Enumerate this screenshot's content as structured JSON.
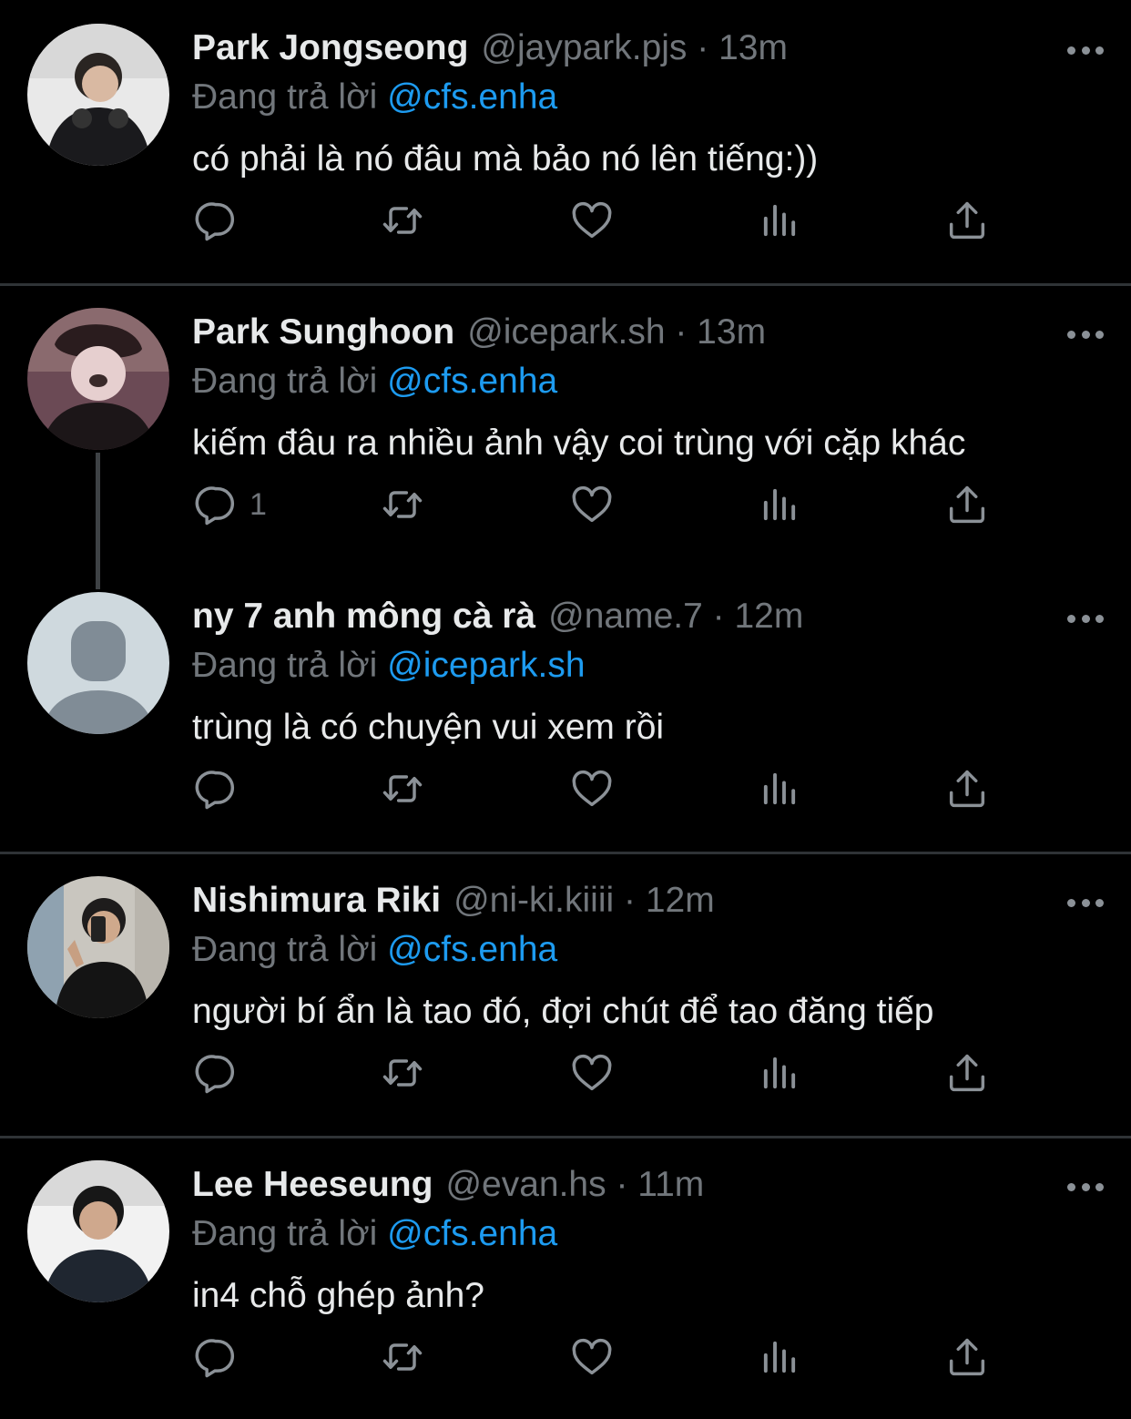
{
  "reply_prefix": "Đang trả lời",
  "tweets": [
    {
      "name": "Park Jongseong",
      "meta": "@jaypark.pjs · 13m",
      "reply_to": "@cfs.enha",
      "text": "có phải là nó đâu mà bảo nó lên tiếng:))",
      "reply_count": ""
    },
    {
      "name": "Park Sunghoon",
      "meta": "@icepark.sh · 13m",
      "reply_to": "@cfs.enha",
      "text": "kiếm đâu ra nhiều ảnh vậy coi trùng với cặp khác",
      "reply_count": "1"
    },
    {
      "name": "ny 7 anh mông cà rà",
      "meta": "@name.7 · 12m",
      "reply_to": "@icepark.sh",
      "text": "trùng là có chuyện vui xem rồi",
      "reply_count": ""
    },
    {
      "name": "Nishimura Riki",
      "meta": "@ni-ki.kiiii · 12m",
      "reply_to": "@cfs.enha",
      "text": "người bí ẩn là tao đó, đợi chút để tao đăng tiếp",
      "reply_count": ""
    },
    {
      "name": "Lee Heeseung",
      "meta": "@evan.hs · 11m",
      "reply_to": "@cfs.enha",
      "text": "in4 chỗ ghép ảnh?",
      "reply_count": ""
    }
  ],
  "colors": {
    "background": "#000000",
    "primary_text": "#e7e9ea",
    "secondary_text": "#71767b",
    "mention": "#1d9bf0",
    "divider": "#2f3336"
  },
  "icons": [
    "reply-icon",
    "retweet-icon",
    "like-icon",
    "analytics-icon",
    "share-icon",
    "more-icon"
  ]
}
